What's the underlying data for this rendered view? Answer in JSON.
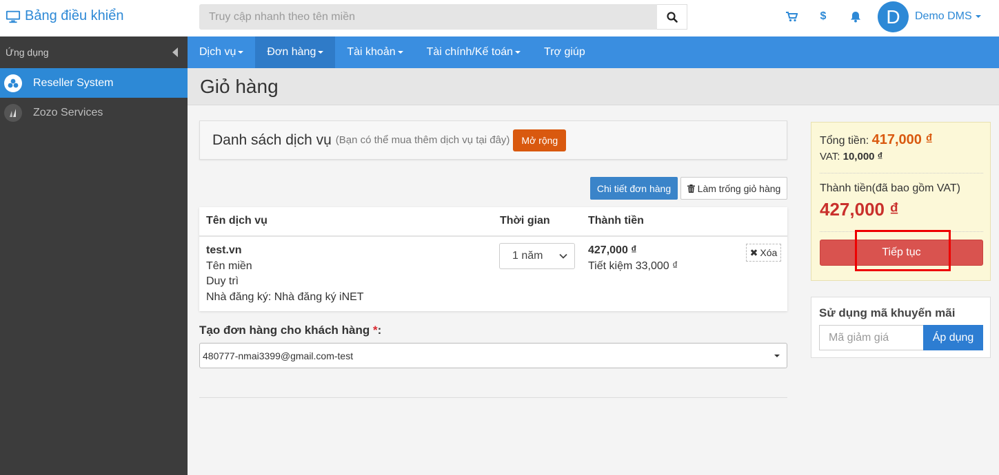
{
  "header": {
    "brand": "Bảng điều khiển",
    "search_placeholder": "Truy cập nhanh theo tên miền",
    "user_initial": "D",
    "user_name": "Demo DMS"
  },
  "sidebar": {
    "title": "Ứng dụng",
    "items": [
      {
        "label": "Reseller System",
        "active": true
      },
      {
        "label": "Zozo Services",
        "active": false
      }
    ]
  },
  "nav": {
    "items": [
      {
        "label": "Dịch vụ"
      },
      {
        "label": "Đơn hàng"
      },
      {
        "label": "Tài khoản"
      },
      {
        "label": "Tài chính/Kế toán"
      },
      {
        "label": "Trợ giúp"
      }
    ]
  },
  "page": {
    "title": "Giỏ hàng"
  },
  "service_list": {
    "heading": "Danh sách dịch vụ",
    "subheading": "(Bạn có thể mua thêm dịch vụ tại đây)",
    "expand_label": "Mở rộng"
  },
  "actions": {
    "order_detail": "Chi tiết đơn hàng",
    "empty_cart": "Làm trống giỏ hàng"
  },
  "cart_table": {
    "headers": {
      "service": "Tên dịch vụ",
      "period": "Thời gian",
      "amount": "Thành tiền"
    },
    "rows": [
      {
        "name": "test.vn",
        "type": "Tên miền",
        "action": "Duy trì",
        "registrar": "Nhà đăng ký: Nhà đăng ký iNET",
        "period": "1 năm",
        "price": "427,000 ₫",
        "saving": "Tiết kiệm 33,000 ₫",
        "delete_label": "Xóa"
      }
    ]
  },
  "customer": {
    "label": "Tạo đơn hàng cho khách hàng",
    "required_mark": "*",
    "colon": ":",
    "selected": "480777-nmai3399@gmail.com-test"
  },
  "summary": {
    "total_label": "Tổng tiền:",
    "total_value": "417,000 ₫",
    "vat_label": "VAT:",
    "vat_value": "10,000 ₫",
    "grand_label": "Thành tiền(đã bao gồm VAT)",
    "grand_value": "427,000 ₫",
    "continue_label": "Tiếp tục"
  },
  "promo": {
    "title": "Sử dụng mã khuyến mãi",
    "placeholder": "Mã giảm giá",
    "apply_label": "Áp dụng"
  },
  "colors": {
    "brand_blue": "#2d89d6",
    "nav_blue": "#3a8ee0",
    "orange": "#d9590f",
    "total_orange": "#d9590f",
    "grand_red": "#c9302c",
    "continue_red": "#d9534f"
  }
}
